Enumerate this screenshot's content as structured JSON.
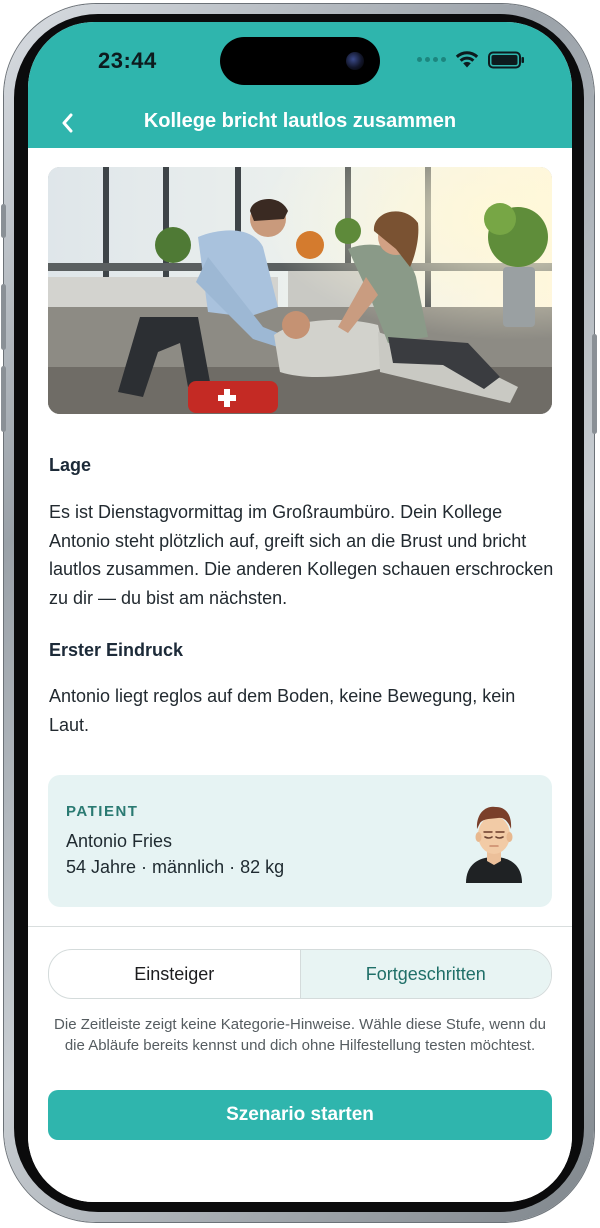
{
  "status_bar": {
    "time": "23:44"
  },
  "nav": {
    "title": "Kollege bricht lautlos zusammen"
  },
  "sections": [
    {
      "title": "Lage",
      "text": "Es ist Dienstagvormittag im Großraumbüro. Dein Kollege Antonio steht plötzlich auf, greift sich an die Brust und bricht lautlos zusammen. Die anderen Kollegen schauen erschrocken zu dir — du bist am nächsten."
    },
    {
      "title": "Erster Eindruck",
      "text": "Antonio liegt reglos auf dem Boden, keine Bewegung, kein Laut."
    }
  ],
  "patient": {
    "label": "PATIENT",
    "name": "Antonio Fries",
    "info": "54 Jahre · männlich · 82 kg"
  },
  "difficulty": {
    "options": [
      "Einsteiger",
      "Fortgeschritten"
    ],
    "selected": "Fortgeschritten",
    "hint": "Die Zeitleiste zeigt keine Kategorie-Hinweise. Wähle diese Stufe, wenn du die Abläufe bereits kennst und dich ohne Hilfestellung testen möchtest."
  },
  "start_button": {
    "label": "Szenario starten"
  },
  "colors": {
    "accent": "#2fb5ad",
    "card_bg": "#e6f3f3",
    "label_teal": "#2a7a72"
  }
}
